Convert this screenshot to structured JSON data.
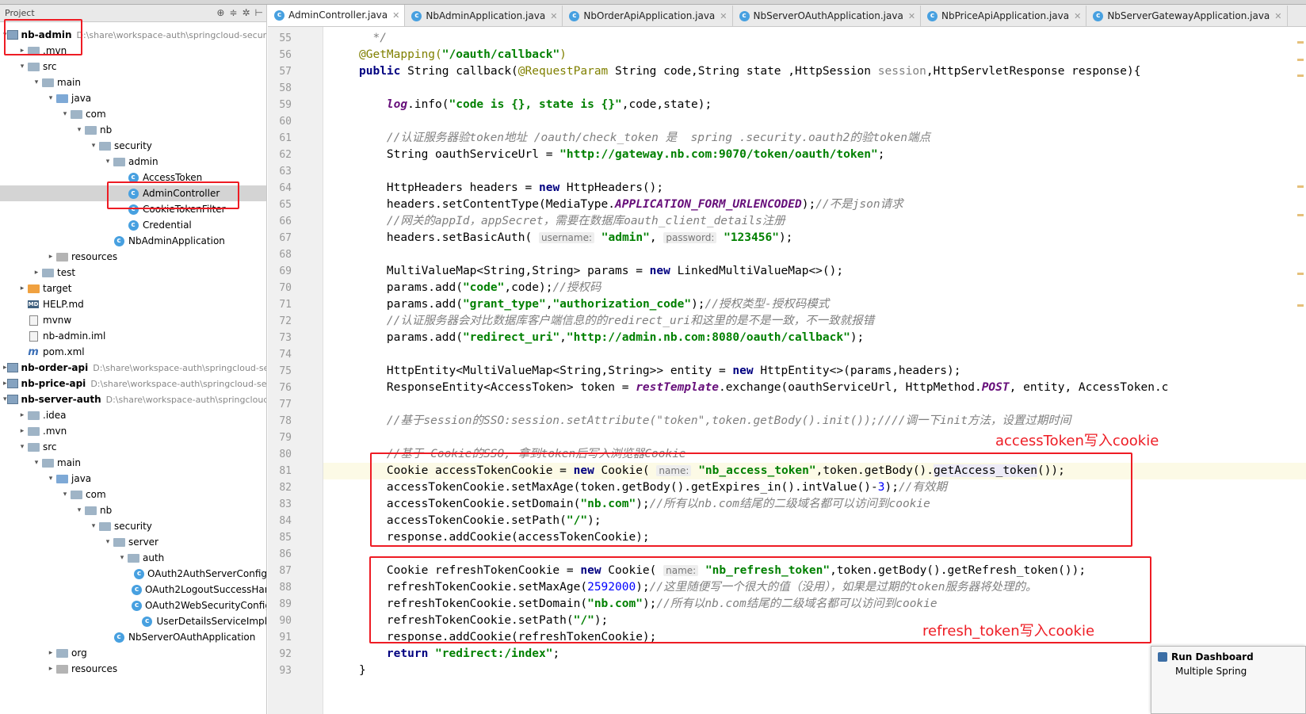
{
  "project_panel": {
    "header_title": "Project",
    "tree": [
      {
        "label": "nb-admin",
        "path": "D:\\share\\workspace-auth\\springcloud-securi",
        "icon": "module",
        "depth": 0,
        "arrow": "▾",
        "bold": true
      },
      {
        "label": ".mvn",
        "icon": "folder",
        "depth": 1,
        "arrow": "▸"
      },
      {
        "label": "src",
        "icon": "folder",
        "depth": 1,
        "arrow": "▾"
      },
      {
        "label": "main",
        "icon": "folder",
        "depth": 2,
        "arrow": "▾"
      },
      {
        "label": "java",
        "icon": "folder-blue",
        "depth": 3,
        "arrow": "▾"
      },
      {
        "label": "com",
        "icon": "folder",
        "depth": 4,
        "arrow": "▾"
      },
      {
        "label": "nb",
        "icon": "folder",
        "depth": 5,
        "arrow": "▾"
      },
      {
        "label": "security",
        "icon": "folder",
        "depth": 6,
        "arrow": "▾"
      },
      {
        "label": "admin",
        "icon": "folder",
        "depth": 7,
        "arrow": "▾"
      },
      {
        "label": "AccessToken",
        "icon": "class",
        "depth": 8,
        "arrow": ""
      },
      {
        "label": "AdminController",
        "icon": "class",
        "depth": 8,
        "arrow": "",
        "selected": true
      },
      {
        "label": "CookieTokenFilter",
        "icon": "class",
        "depth": 8,
        "arrow": ""
      },
      {
        "label": "Credential",
        "icon": "class",
        "depth": 8,
        "arrow": ""
      },
      {
        "label": "NbAdminApplication",
        "icon": "class",
        "depth": 7,
        "arrow": ""
      },
      {
        "label": "resources",
        "icon": "folder-gray",
        "depth": 3,
        "arrow": "▸"
      },
      {
        "label": "test",
        "icon": "folder",
        "depth": 2,
        "arrow": "▸"
      },
      {
        "label": "target",
        "icon": "folder-orange",
        "depth": 1,
        "arrow": "▸"
      },
      {
        "label": "HELP.md",
        "icon": "md",
        "depth": 1,
        "arrow": ""
      },
      {
        "label": "mvnw",
        "icon": "file",
        "depth": 1,
        "arrow": ""
      },
      {
        "label": "nb-admin.iml",
        "icon": "file",
        "depth": 1,
        "arrow": ""
      },
      {
        "label": "pom.xml",
        "icon": "pom",
        "depth": 1,
        "arrow": ""
      },
      {
        "label": "nb-order-api",
        "path": "D:\\share\\workspace-auth\\springcloud-sec",
        "icon": "module",
        "depth": 0,
        "arrow": "▸",
        "bold": true
      },
      {
        "label": "nb-price-api",
        "path": "D:\\share\\workspace-auth\\springcloud-sec",
        "icon": "module",
        "depth": 0,
        "arrow": "▸",
        "bold": true
      },
      {
        "label": "nb-server-auth",
        "path": "D:\\share\\workspace-auth\\springcloud-s",
        "icon": "module",
        "depth": 0,
        "arrow": "▾",
        "bold": true
      },
      {
        "label": ".idea",
        "icon": "folder",
        "depth": 1,
        "arrow": "▸"
      },
      {
        "label": ".mvn",
        "icon": "folder",
        "depth": 1,
        "arrow": "▸"
      },
      {
        "label": "src",
        "icon": "folder",
        "depth": 1,
        "arrow": "▾"
      },
      {
        "label": "main",
        "icon": "folder",
        "depth": 2,
        "arrow": "▾"
      },
      {
        "label": "java",
        "icon": "folder-blue",
        "depth": 3,
        "arrow": "▾"
      },
      {
        "label": "com",
        "icon": "folder",
        "depth": 4,
        "arrow": "▾"
      },
      {
        "label": "nb",
        "icon": "folder",
        "depth": 5,
        "arrow": "▾"
      },
      {
        "label": "security",
        "icon": "folder",
        "depth": 6,
        "arrow": "▾"
      },
      {
        "label": "server",
        "icon": "folder",
        "depth": 7,
        "arrow": "▾"
      },
      {
        "label": "auth",
        "icon": "folder",
        "depth": 8,
        "arrow": "▾"
      },
      {
        "label": "OAuth2AuthServerConfig",
        "icon": "class",
        "depth": 9,
        "arrow": ""
      },
      {
        "label": "OAuth2LogoutSuccessHan",
        "icon": "class",
        "depth": 9,
        "arrow": ""
      },
      {
        "label": "OAuth2WebSecurityConfig",
        "icon": "class",
        "depth": 9,
        "arrow": ""
      },
      {
        "label": "UserDetailsServiceImpl",
        "icon": "class",
        "depth": 9,
        "arrow": ""
      },
      {
        "label": "NbServerOAuthApplication",
        "icon": "class",
        "depth": 7,
        "arrow": ""
      },
      {
        "label": "org",
        "icon": "folder",
        "depth": 3,
        "arrow": "▸"
      },
      {
        "label": "resources",
        "icon": "folder-gray",
        "depth": 3,
        "arrow": "▸"
      }
    ]
  },
  "tabs": [
    {
      "label": "AdminController.java",
      "active": true
    },
    {
      "label": "NbAdminApplication.java"
    },
    {
      "label": "NbOrderApiApplication.java"
    },
    {
      "label": "NbServerOAuthApplication.java"
    },
    {
      "label": "NbPriceApiApplication.java"
    },
    {
      "label": "NbServerGatewayApplication.java"
    }
  ],
  "code": {
    "line_numbers": [
      "55",
      "56",
      "57",
      "58",
      "59",
      "60",
      "61",
      "62",
      "63",
      "64",
      "65",
      "66",
      "67",
      "68",
      "69",
      "70",
      "71",
      "72",
      "73",
      "74",
      "75",
      "76",
      "77",
      "78",
      "79",
      "80",
      "81",
      "82",
      "83",
      "84",
      "85",
      "86",
      "87",
      "88",
      "89",
      "90",
      "91",
      "92",
      "93"
    ],
    "lines": [
      {
        "n": 55,
        "tokens": [
          [
            "cm",
            "  */"
          ]
        ]
      },
      {
        "n": 56,
        "tokens": [
          [
            "ann",
            "@GetMapping("
          ],
          [
            "str",
            "\"/oauth/callback\""
          ],
          [
            "ann",
            ")"
          ]
        ]
      },
      {
        "n": 57,
        "tokens": [
          [
            "kw",
            "public "
          ],
          [
            "",
            "String callback("
          ],
          [
            "ann",
            "@RequestParam "
          ],
          [
            "",
            "String code,String state ,HttpSession "
          ],
          [
            "unused",
            "session"
          ],
          [
            "",
            ",HttpServletResponse response){"
          ]
        ]
      },
      {
        "n": 58,
        "tokens": []
      },
      {
        "n": 59,
        "tokens": [
          [
            "fld",
            "    log"
          ],
          [
            "",
            ".info("
          ],
          [
            "str",
            "\"code is {}, state is {}\""
          ],
          [
            "",
            ",code,state);"
          ]
        ]
      },
      {
        "n": 60,
        "tokens": []
      },
      {
        "n": 61,
        "tokens": [
          [
            "cm",
            "    //认证服务器验token地址 /oauth/check_token 是  spring .security.oauth2的验token端点"
          ]
        ]
      },
      {
        "n": 62,
        "tokens": [
          [
            "",
            "    String oauthServiceUrl = "
          ],
          [
            "str",
            "\"http://gateway.nb.com:9070/token/oauth/token\""
          ],
          [
            "",
            ";"
          ]
        ]
      },
      {
        "n": 63,
        "tokens": []
      },
      {
        "n": 64,
        "tokens": [
          [
            "",
            "    HttpHeaders headers = "
          ],
          [
            "kw",
            "new "
          ],
          [
            "",
            "HttpHeaders();"
          ]
        ]
      },
      {
        "n": 65,
        "tokens": [
          [
            "",
            "    headers.setContentType(MediaType."
          ],
          [
            "static",
            "APPLICATION_FORM_URLENCODED"
          ],
          [
            "",
            ");"
          ],
          [
            "cm",
            "//不是json请求"
          ]
        ]
      },
      {
        "n": 66,
        "tokens": [
          [
            "cm",
            "    //网关的appId，appSecret，需要在数据库oauth_client_details注册"
          ]
        ]
      },
      {
        "n": 67,
        "tokens": [
          [
            "",
            "    headers.setBasicAuth( "
          ],
          [
            "hint",
            "username:"
          ],
          [
            "",
            " "
          ],
          [
            "str",
            "\"admin\""
          ],
          [
            "",
            ", "
          ],
          [
            "hint",
            "password:"
          ],
          [
            "",
            " "
          ],
          [
            "str",
            "\"123456\""
          ],
          [
            "",
            ");"
          ]
        ]
      },
      {
        "n": 68,
        "tokens": []
      },
      {
        "n": 69,
        "tokens": [
          [
            "",
            "    MultiValueMap<String,String> params = "
          ],
          [
            "kw",
            "new "
          ],
          [
            "",
            "LinkedMultiValueMap<>();"
          ]
        ]
      },
      {
        "n": 70,
        "tokens": [
          [
            "",
            "    params.add("
          ],
          [
            "str",
            "\"code\""
          ],
          [
            "",
            ",code);"
          ],
          [
            "cm",
            "//授权码"
          ]
        ]
      },
      {
        "n": 71,
        "tokens": [
          [
            "",
            "    params.add("
          ],
          [
            "str",
            "\"grant_type\""
          ],
          [
            "",
            ","
          ],
          [
            "str",
            "\"authorization_code\""
          ],
          [
            "",
            ");"
          ],
          [
            "cm",
            "//授权类型-授权码模式"
          ]
        ]
      },
      {
        "n": 72,
        "tokens": [
          [
            "cm",
            "    //认证服务器会对比数据库客户端信息的的redirect_uri和这里的是不是一致，不一致就报错"
          ]
        ]
      },
      {
        "n": 73,
        "tokens": [
          [
            "",
            "    params.add("
          ],
          [
            "str",
            "\"redirect_uri\""
          ],
          [
            "",
            ","
          ],
          [
            "str",
            "\"http://admin.nb.com:8080/oauth/callback\""
          ],
          [
            "",
            ");"
          ]
        ]
      },
      {
        "n": 74,
        "tokens": []
      },
      {
        "n": 75,
        "tokens": [
          [
            "",
            "    HttpEntity<MultiValueMap<String,String>> entity = "
          ],
          [
            "kw",
            "new "
          ],
          [
            "",
            "HttpEntity<>(params,headers);"
          ]
        ]
      },
      {
        "n": 76,
        "tokens": [
          [
            "",
            "    ResponseEntity<AccessToken> token = "
          ],
          [
            "fld",
            "restTemplate"
          ],
          [
            "",
            ".exchange(oauthServiceUrl, HttpMethod."
          ],
          [
            "static",
            "POST"
          ],
          [
            "",
            ", entity, AccessToken.c"
          ]
        ]
      },
      {
        "n": 77,
        "tokens": []
      },
      {
        "n": 78,
        "tokens": [
          [
            "cm",
            "    //基于session的SSO:session.setAttribute(\"token\",token.getBody().init());////调一下init方法，设置过期时间"
          ]
        ]
      },
      {
        "n": 79,
        "tokens": []
      },
      {
        "n": 80,
        "tokens": [
          [
            "cm",
            "    //基于 Cookie的SSO, 拿到token后写入浏览器Cookie"
          ]
        ]
      },
      {
        "n": 81,
        "tokens": [
          [
            "",
            "    Cookie accessTokenCookie = "
          ],
          [
            "kw",
            "new "
          ],
          [
            "",
            "Cookie( "
          ],
          [
            "hint",
            "name:"
          ],
          [
            "",
            " "
          ],
          [
            "str",
            "\"nb_access_token\""
          ],
          [
            "",
            ",token.getBody()."
          ],
          [
            "method-hl",
            "getAccess_token"
          ],
          [
            "",
            "());"
          ]
        ],
        "highlight": true
      },
      {
        "n": 82,
        "tokens": [
          [
            "",
            "    accessTokenCookie.setMaxAge(token.getBody().getExpires_in().intValue()-"
          ],
          [
            "num",
            "3"
          ],
          [
            "",
            ");"
          ],
          [
            "cm",
            "//有效期"
          ]
        ]
      },
      {
        "n": 83,
        "tokens": [
          [
            "",
            "    accessTokenCookie.setDomain("
          ],
          [
            "str",
            "\"nb.com\""
          ],
          [
            "",
            ");"
          ],
          [
            "cm",
            "//所有以nb.com结尾的二级域名都可以访问到cookie"
          ]
        ]
      },
      {
        "n": 84,
        "tokens": [
          [
            "",
            "    accessTokenCookie.setPath("
          ],
          [
            "str",
            "\"/\""
          ],
          [
            "",
            ");"
          ]
        ]
      },
      {
        "n": 85,
        "tokens": [
          [
            "",
            "    response.addCookie(accessTokenCookie);"
          ]
        ]
      },
      {
        "n": 86,
        "tokens": []
      },
      {
        "n": 87,
        "tokens": [
          [
            "",
            "    Cookie refreshTokenCookie = "
          ],
          [
            "kw",
            "new "
          ],
          [
            "",
            "Cookie( "
          ],
          [
            "hint",
            "name:"
          ],
          [
            "",
            " "
          ],
          [
            "str",
            "\"nb_refresh_token\""
          ],
          [
            "",
            ",token.getBody().getRefresh_token());"
          ]
        ]
      },
      {
        "n": 88,
        "tokens": [
          [
            "",
            "    refreshTokenCookie.setMaxAge("
          ],
          [
            "num",
            "2592000"
          ],
          [
            "",
            ");"
          ],
          [
            "cm",
            "//这里随便写一个很大的值（没用），如果是过期的token服务器将处理的。"
          ]
        ]
      },
      {
        "n": 89,
        "tokens": [
          [
            "",
            "    refreshTokenCookie.setDomain("
          ],
          [
            "str",
            "\"nb.com\""
          ],
          [
            "",
            ");"
          ],
          [
            "cm",
            "//所有以nb.com结尾的二级域名都可以访问到cookie"
          ]
        ]
      },
      {
        "n": 90,
        "tokens": [
          [
            "",
            "    refreshTokenCookie.setPath("
          ],
          [
            "str",
            "\"/\""
          ],
          [
            "",
            ");"
          ]
        ]
      },
      {
        "n": 91,
        "tokens": [
          [
            "",
            "    response.addCookie(refreshTokenCookie);"
          ]
        ]
      },
      {
        "n": 92,
        "tokens": [
          [
            "kw",
            "    return "
          ],
          [
            "str",
            "\"redirect:/index\""
          ],
          [
            "",
            ";"
          ]
        ]
      },
      {
        "n": 93,
        "tokens": [
          [
            "",
            "}"
          ]
        ]
      }
    ]
  },
  "annotations": {
    "access_label": "accessToken写入cookie",
    "refresh_label": "refresh_token写入cookie"
  },
  "run_dashboard": {
    "title": "Run Dashboard",
    "subtitle": "Multiple Spring"
  },
  "colors": {
    "annotation_red": "#ee1c24",
    "class_icon": "#47a0e0",
    "keyword": "#000080",
    "string": "#008000",
    "comment": "#808080"
  }
}
